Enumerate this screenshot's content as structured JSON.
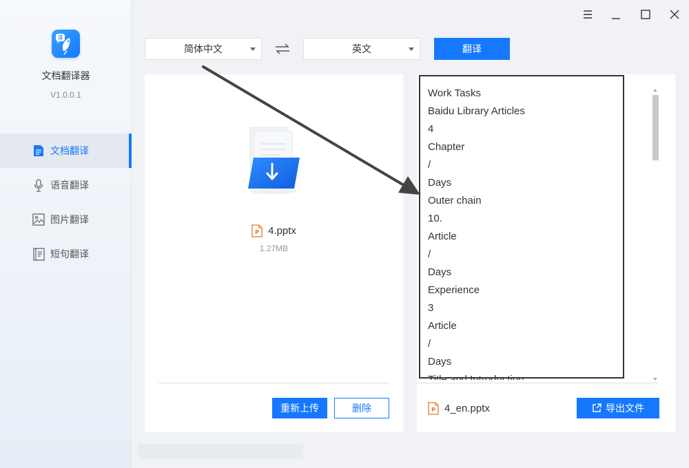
{
  "app": {
    "name": "文档翻译器",
    "version": "V1.0.0.1"
  },
  "sidebar": {
    "items": [
      {
        "label": "文档翻译",
        "icon": "document-icon",
        "active": true
      },
      {
        "label": "语音翻译",
        "icon": "microphone-icon",
        "active": false
      },
      {
        "label": "图片翻译",
        "icon": "image-icon",
        "active": false
      },
      {
        "label": "短句翻译",
        "icon": "sentence-icon",
        "active": false
      }
    ]
  },
  "window_controls": [
    "menu-icon",
    "minimize-icon",
    "maximize-icon",
    "close-icon"
  ],
  "toolbar": {
    "source_lang": "简体中文",
    "target_lang": "英文",
    "translate_label": "翻译"
  },
  "source_panel": {
    "file_name": "4.pptx",
    "file_size": "1.27MB",
    "reupload_label": "重新上传",
    "delete_label": "删除"
  },
  "result_panel": {
    "lines": [
      "Work Tasks",
      "Baidu Library Articles",
      "4",
      "Chapter",
      "/",
      "Days",
      "Outer chain",
      "10.",
      "Article",
      "/",
      "Days",
      "Experience",
      "3",
      "Article",
      "/",
      "Days",
      "Title and Introduction"
    ],
    "output_file": "4_en.pptx",
    "export_label": "导出文件"
  },
  "colors": {
    "accent": "#1677ff",
    "panel_bg": "#ffffff",
    "app_bg": "#f0f2f5"
  }
}
